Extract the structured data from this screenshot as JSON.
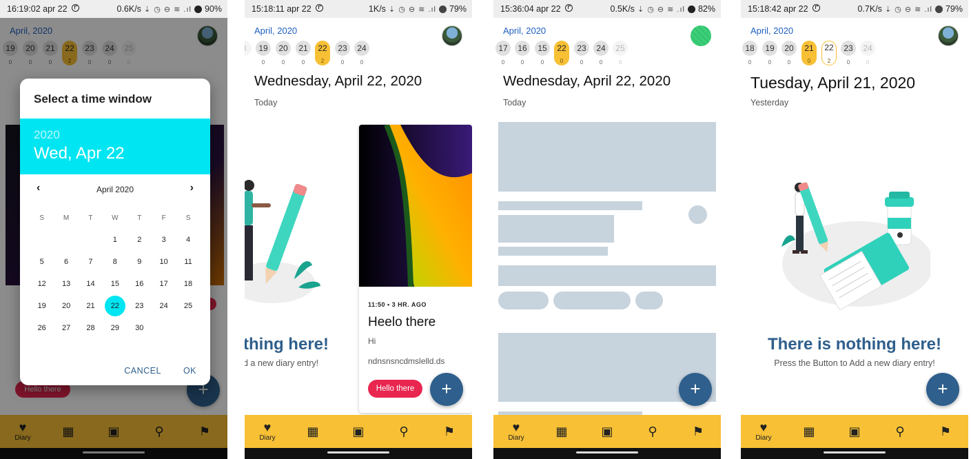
{
  "screens": [
    {
      "status": {
        "time": "16:19:02 apr 22",
        "speed": "0.6K/s",
        "battery": "90%"
      },
      "month_label": "April, 2020",
      "days": [
        {
          "day": "19",
          "count": "0"
        },
        {
          "day": "20",
          "count": "0"
        },
        {
          "day": "21",
          "count": "0"
        },
        {
          "day": "22",
          "count": "2"
        },
        {
          "day": "23",
          "count": "0"
        },
        {
          "day": "24",
          "count": "0"
        },
        {
          "day": "25",
          "count": "0"
        }
      ],
      "date_dialog": {
        "title": "Select a time window",
        "year": "2020",
        "selected_date": "Wed, Apr 22",
        "month": "April 2020",
        "weekdays": [
          "S",
          "M",
          "T",
          "W",
          "T",
          "F",
          "S"
        ],
        "weeks": [
          [
            "",
            "",
            "",
            "1",
            "2",
            "3",
            "4"
          ],
          [
            "5",
            "6",
            "7",
            "8",
            "9",
            "10",
            "11"
          ],
          [
            "12",
            "13",
            "14",
            "15",
            "16",
            "17",
            "18"
          ],
          [
            "19",
            "20",
            "21",
            "22",
            "23",
            "24",
            "25"
          ],
          [
            "26",
            "27",
            "28",
            "29",
            "30",
            "",
            ""
          ]
        ],
        "selected_day": "22",
        "cancel_label": "CANCEL",
        "ok_label": "OK"
      },
      "background_chip": "Hello there",
      "nav_label": "Diary"
    },
    {
      "status": {
        "time": "15:18:11 apr 22",
        "speed": "1K/s",
        "battery": "79%"
      },
      "month_label": "April, 2020",
      "days": [
        {
          "day": "19",
          "count": "0"
        },
        {
          "day": "20",
          "count": "0"
        },
        {
          "day": "21",
          "count": "0"
        },
        {
          "day": "22",
          "count": "2"
        },
        {
          "day": "23",
          "count": "0"
        },
        {
          "day": "24",
          "count": "0"
        }
      ],
      "title": "Wednesday, April 22, 2020",
      "subtitle": "Today",
      "empty_title_clipped": "thing here!",
      "empty_sub_clipped": "d a new diary entry!",
      "entry": {
        "meta": "11:50 • 3 HR. AGO",
        "title": "Heelo there",
        "subtitle": "Hi",
        "body": "ndnsnsncdmslelld.ds",
        "chip": "Hello there"
      },
      "nav_label": "Diary"
    },
    {
      "status": {
        "time": "15:36:04 apr 22",
        "speed": "0.5K/s",
        "battery": "82%"
      },
      "month_label": "April, 2020",
      "days": [
        {
          "day": "17",
          "count": "0"
        },
        {
          "day": "16",
          "count": "0"
        },
        {
          "day": "15",
          "count": "0"
        },
        {
          "day": "22",
          "count": "0"
        },
        {
          "day": "23",
          "count": "0"
        },
        {
          "day": "24",
          "count": "0"
        },
        {
          "day": "25",
          "count": "0"
        }
      ],
      "title": "Wednesday, April 22, 2020",
      "subtitle": "Today",
      "nav_label": "Diary"
    },
    {
      "status": {
        "time": "15:18:42 apr 22",
        "speed": "0.7K/s",
        "battery": "79%"
      },
      "month_label": "April, 2020",
      "days": [
        {
          "day": "18",
          "count": "0"
        },
        {
          "day": "19",
          "count": "0"
        },
        {
          "day": "20",
          "count": "0"
        },
        {
          "day": "21",
          "count": "0"
        },
        {
          "day": "22",
          "count": "2"
        },
        {
          "day": "23",
          "count": "0"
        },
        {
          "day": "24",
          "count": "0"
        }
      ],
      "title": "Tuesday, April 21, 2020",
      "subtitle": "Yesterday",
      "empty_title": "There is nothing here!",
      "empty_sub": "Press the Button to Add a new diary entry!",
      "nav_label": "Diary"
    }
  ],
  "fab_symbol": "+",
  "nav_icons": [
    "heart-icon",
    "dashboard-icon",
    "calendar-icon",
    "search-icon",
    "flag-icon"
  ],
  "colors": {
    "accent_yellow": "#f7c035",
    "primary_blue": "#2f5f8c",
    "dialog_cyan": "#00e5f2",
    "chip_red": "#e8264f",
    "skeleton": "#c7d3dd"
  }
}
